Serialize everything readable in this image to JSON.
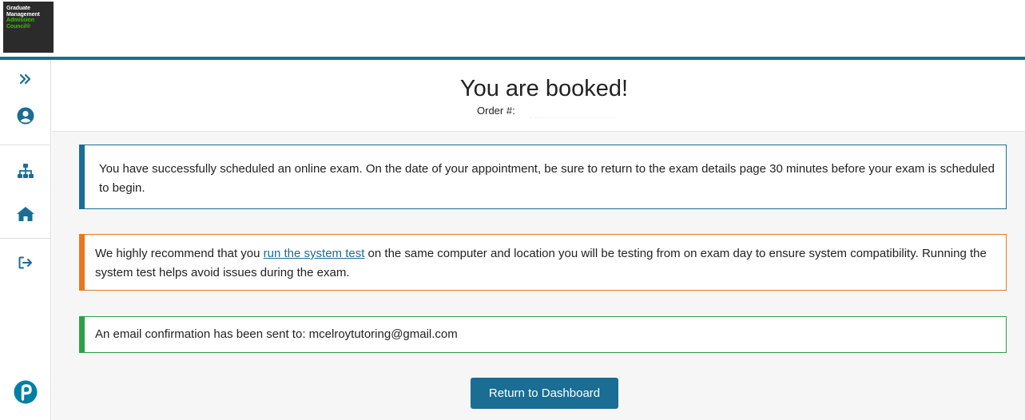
{
  "brand": {
    "logo_lines_white": [
      "Graduate",
      "Management"
    ],
    "logo_lines_green": [
      "Admission",
      "Council®"
    ]
  },
  "sidebar": {
    "icons": [
      "double-chevron-right-icon",
      "user-icon",
      "sitemap-icon",
      "home-icon",
      "sign-out-icon",
      "pearson-logo-icon"
    ]
  },
  "header": {
    "title": "You are booked!",
    "order_label": "Order #:",
    "order_value": ""
  },
  "cards": {
    "schedule_text": "You have successfully scheduled an online exam. On the date of your appointment, be sure to return to the exam details page 30 minutes before your exam is scheduled to begin.",
    "system_prefix": "We highly recommend that you ",
    "system_link": "run the system test",
    "system_suffix": " on the same computer and location you will be testing from on exam day to ensure system compatibility. Running the system test helps avoid issues during the exam.",
    "email_text": "An email confirmation has been sent to: mcelroytutoring@gmail.com"
  },
  "actions": {
    "dashboard_button": "Return to Dashboard"
  },
  "colors": {
    "primary": "#1a6d93",
    "warning": "#e8781f",
    "success": "#2e9e4a",
    "pearson": "#007fa3"
  }
}
